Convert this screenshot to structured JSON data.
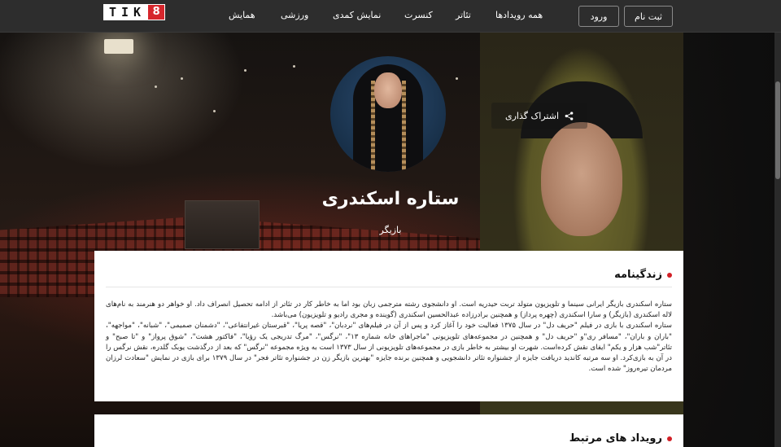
{
  "nav": {
    "logo_text": "TIK",
    "logo_badge": "8",
    "items": [
      {
        "label": "همه رویدادها"
      },
      {
        "label": "تئاتر"
      },
      {
        "label": "کنسرت"
      },
      {
        "label": "نمایش کمدی"
      },
      {
        "label": "ورزشی"
      },
      {
        "label": "همایش"
      }
    ],
    "signup_label": "ثبت نام",
    "login_label": "ورود"
  },
  "hero": {
    "share_label": "اشتراک گذاری",
    "name": "ستاره اسکندری",
    "role": "بازیگر"
  },
  "bio": {
    "title": "زندگینامه",
    "paragraphs": [
      "ستاره اسکندری بازیگر ایرانی سینما و تلویزیون متولد تربت حیدریه است. او دانشجوی رشته مترجمی زبان بود اما به خاطر کار در تئاتر از ادامه تحصیل انصراف داد. او خواهر دو هنرمند به نام‌های لاله اسکندری (بازیگر) و سارا اسکندری (چهره پرداز) و همچنین برادرزاده عبدالحسین اسکندری (گوینده و مجری رادیو و تلویزیون) می‌باشد.",
      "ستاره اسکندری با بازی در فیلم \"حریف دل\" در سال ۱۳۷۵ فعالیت خود را آغاز کرد و پس از آن در فیلم‌های \"نردبان\"، \"قصه پریا\"، \"قبرستان غیرانتفاعی\"، \"دشمنان صمیمی\"، \"شبانه\"، \"مواجهه\"، \"باران و باران\"، \"مسافر ری\"و \"حریف دل\" و همچنین در مجموعه‌های تلویزیونی \"ماجراهای خانه شماره ۱۳\"، \"نرگس\"، \"مرگ تدریجی یک رؤیا\"، \"فاکتور هشت\"، \"شوق پرواز\" و \"تا صبح\" و تئاتر\"شب هزار و یکم\" ایفای نقش کرده‌است. شهرت او بیشتر به خاطر بازی در مجموعه‌های تلویزیونی از سال ۱۳۷۳ است به ویژه مجموعه \"نرگس\" که بعد از درگذشت یوبک گلدره، نقش نرگس را در آن به بازی‌کرد. او سه مرتبه کاندید دریافت جایزه از جشنواره تئاتر دانشجویی و همچنین برنده جایزه \"بهترین بازیگر زن در جشنواره تئاتر فجر\" در سال ۱۳۷۹ برای بازی در نمایش \"سعادت لرزان مردمان تیره‌روز\" شده است."
    ]
  },
  "related": {
    "title": "رویداد های مرتبط"
  },
  "icons": {
    "share": "share-icon",
    "bullet": "red-dot"
  },
  "colors": {
    "accent": "#d21f26",
    "logo_badge_bg": "#d6262c",
    "topbar_bg": "#2d2d2d"
  }
}
